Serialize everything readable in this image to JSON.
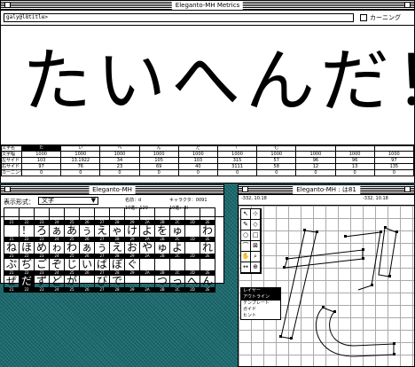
{
  "metrics_window": {
    "title": "Eleganto-MH Metrics",
    "sample_text": "galy@l8title>",
    "kerning_label": "カーニング",
    "preview_text": "たいへんだ！む",
    "table": {
      "row_labels": [
        "文字名",
        "文字幅",
        "左サイド",
        "右サイド",
        "カーニング"
      ],
      "columns": [
        [
          "た",
          "1000",
          "103",
          "97",
          "0"
        ],
        [
          "い",
          "1000",
          "13.1922",
          "76",
          "0"
        ],
        [
          "へ",
          "1000",
          "34",
          "23",
          "0"
        ],
        [
          "ん",
          "1000",
          "105",
          "69",
          "0"
        ],
        [
          "だ",
          "1000",
          "103",
          "40",
          "0"
        ],
        [
          "！",
          "1000",
          "315",
          "3111",
          "0"
        ],
        [
          "む",
          "1000",
          "57",
          "58",
          "0"
        ],
        [
          "",
          "1000",
          "96",
          "12",
          "0"
        ],
        [
          "",
          "1000",
          "96",
          "13",
          "0"
        ],
        [
          "",
          "1000",
          "97",
          "135",
          "0"
        ]
      ]
    }
  },
  "char_window": {
    "title": "Eleganto-MH",
    "display_label": "表示形式：",
    "display_value": "文字",
    "meta": [
      {
        "label": "名前：d",
        "pos": "a"
      },
      {
        "label": "キャラクタ：0091",
        "pos": "b"
      },
      {
        "label": "10進：129",
        "pos": "c"
      },
      {
        "label": "10進：8l",
        "pos": "d"
      }
    ],
    "rows": [
      [
        "",
        "",
        "",
        "",
        "",
        "",
        "",
        "",
        "",
        "",
        "",
        "",
        "",
        ""
      ],
      [
        "",
        "！",
        "ろ",
        "ぁ",
        "あ",
        "ぅ",
        "え",
        "ゃ",
        "け",
        "よ",
        "を",
        "ゅ",
        "",
        "わ"
      ],
      [
        "ね",
        "ほ",
        "め",
        "ゎ",
        "わ",
        "ぁ",
        "ぅ",
        "え",
        "お",
        "や",
        "ゅ",
        "よ",
        "",
        "れ"
      ],
      [
        "ぷ",
        "ぢ",
        "ご",
        "ぞ",
        "じ",
        "い",
        "ば",
        "ぽ",
        "ぐ",
        "",
        "",
        "",
        "",
        ""
      ],
      [
        "ぜ",
        "だ",
        "ず",
        "ど",
        "が",
        "",
        "び",
        "で",
        "",
        "",
        "つ",
        "っ",
        "へ",
        "ん"
      ]
    ],
    "codes": [
      "21",
      "22",
      "23",
      "24",
      "25",
      "26",
      "27",
      "28",
      "29",
      "2A",
      "2B",
      "2C",
      "2D",
      "2E"
    ]
  },
  "glyph_window": {
    "title": "Eleganto-MH : は81",
    "ruler_left": "-332, 10.18",
    "ruler_right": "-332, 10.18",
    "tools": [
      "↖",
      "⊹",
      "✎",
      "◇",
      "○",
      "□",
      "⌒",
      "⊠",
      "✋",
      "⌕",
      "↔",
      "⊕"
    ],
    "layers_header": "レイヤー",
    "layers": [
      "アウトライン",
      "テンプレート",
      "ガイド",
      "ヒント"
    ]
  }
}
